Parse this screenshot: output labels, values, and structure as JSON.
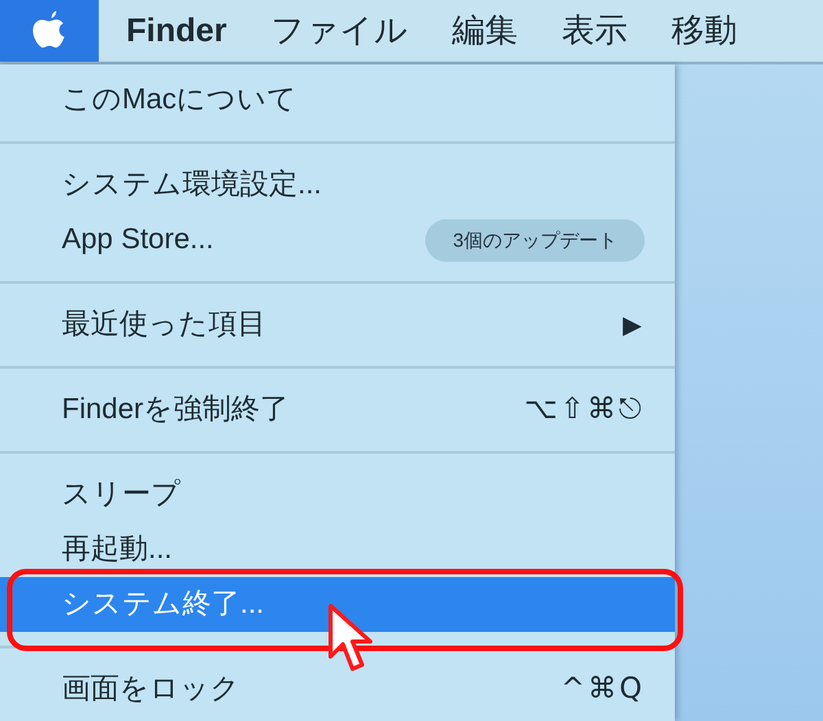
{
  "menu_bar": {
    "apple_selected": true,
    "items": [
      {
        "label": "Finder",
        "bold": true
      },
      {
        "label": "ファイル",
        "bold": false
      },
      {
        "label": "編集",
        "bold": false
      },
      {
        "label": "表示",
        "bold": false
      },
      {
        "label": "移動",
        "bold": false
      }
    ]
  },
  "apple_menu": [
    {
      "kind": "item",
      "label": "このMacについて",
      "selected": false
    },
    {
      "kind": "separator"
    },
    {
      "kind": "item",
      "label": "システム環境設定...",
      "selected": false
    },
    {
      "kind": "item",
      "label": "App Store...",
      "badge": "3個のアップデート",
      "selected": false
    },
    {
      "kind": "separator"
    },
    {
      "kind": "item",
      "label": "最近使った項目",
      "submenu": "▶",
      "selected": false
    },
    {
      "kind": "separator"
    },
    {
      "kind": "item",
      "label": "Finderを強制終了",
      "shortcut": "⌥⇧⌘⎋",
      "selected": false
    },
    {
      "kind": "separator"
    },
    {
      "kind": "item",
      "label": "スリープ",
      "selected": false
    },
    {
      "kind": "item",
      "label": "再起動...",
      "selected": false
    },
    {
      "kind": "item",
      "label": "システム終了...",
      "selected": true,
      "circled": true,
      "pointer": true
    },
    {
      "kind": "separator"
    },
    {
      "kind": "item",
      "label": "画面をロック",
      "shortcut": "^⌘Q",
      "selected": false
    }
  ]
}
